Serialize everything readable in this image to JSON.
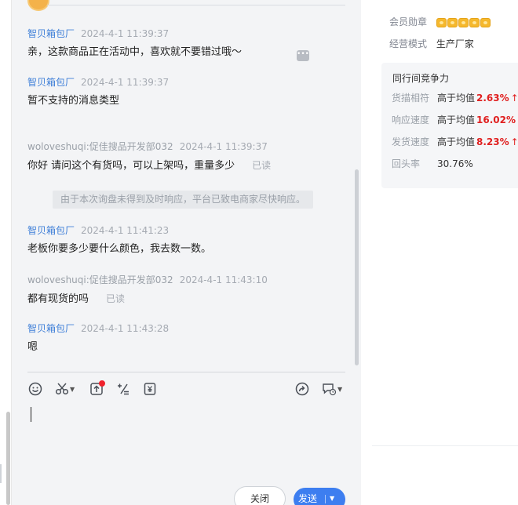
{
  "chat": {
    "messages": [
      {
        "sender": "智贝箱包厂",
        "time": "2024-4-1 11:39:37",
        "text": "亲，这款商品正在活动中，喜欢就不要错过哦～",
        "role": "seller"
      },
      {
        "sender": "智贝箱包厂",
        "time": "2024-4-1 11:39:37",
        "text": "暂不支持的消息类型",
        "role": "seller"
      },
      {
        "sender": "woloveshuqi:促佳搜品开发部032",
        "time": "2024-4-1 11:39:37",
        "text": "你好 请问这个有货吗，可以上架吗，重量多少",
        "read": "已读",
        "role": "customer"
      },
      {
        "sender": "智贝箱包厂",
        "time": "2024-4-1 11:41:23",
        "text": "老板你要多少要什么颜色，我去数一数。",
        "role": "seller"
      },
      {
        "sender": "woloveshuqi:促佳搜品开发部032",
        "time": "2024-4-1 11:43:10",
        "text": "都有现货的吗",
        "read": "已读",
        "role": "customer"
      },
      {
        "sender": "智贝箱包厂",
        "time": "2024-4-1 11:43:28",
        "text": "嗯",
        "role": "seller"
      }
    ],
    "system_notice": "由于本次询盘未得到及时响应，平台已致电商家尽快响应。"
  },
  "toolbar": {
    "icons": [
      "emoji-icon",
      "scissors-icon",
      "upload-icon",
      "formula-icon",
      "price-tag-icon",
      "forward-icon",
      "quick-reply-icon"
    ]
  },
  "actions": {
    "close_label": "关闭",
    "send_label": "发送"
  },
  "info": {
    "badge_label": "会员勋章",
    "mode_label": "经营模式",
    "mode_value": "生产厂家",
    "competition_title": "同行间竞争力",
    "metrics": [
      {
        "label": "货描相符",
        "text": "高于均值",
        "value": "2.63%",
        "arrow": "↑"
      },
      {
        "label": "响应速度",
        "text": "高于均值",
        "value": "16.02%",
        "arrow": "↑"
      },
      {
        "label": "发货速度",
        "text": "高于均值",
        "value": "8.23%",
        "arrow": "↑"
      },
      {
        "label": "回头率",
        "text": "30.76%",
        "value": "",
        "arrow": ""
      }
    ],
    "colors": {
      "accent": "#3d7ef0",
      "up": "#e02020",
      "seller_name": "#3f7fd8"
    }
  }
}
